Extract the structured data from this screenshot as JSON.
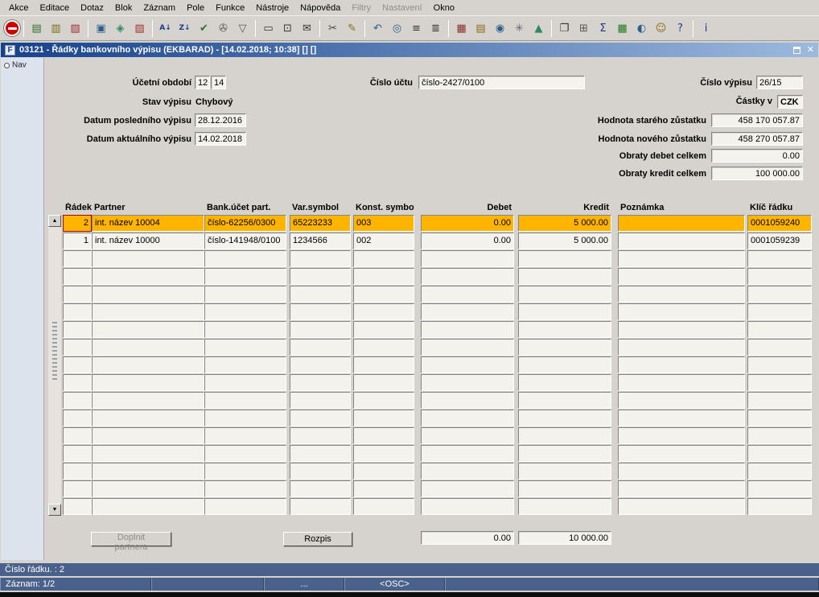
{
  "colors": {
    "window_bg": "#d6d3ce",
    "field_bg": "#f4f2ec",
    "selected_row": "#ffb400",
    "titlebar_start": "#16418c",
    "titlebar_end": "#9db9dd",
    "status_bar": "#4a618c",
    "exit_red": "#cc0000"
  },
  "menu": {
    "items": [
      {
        "label": "Akce",
        "enabled": true
      },
      {
        "label": "Editace",
        "enabled": true
      },
      {
        "label": "Dotaz",
        "enabled": true
      },
      {
        "label": "Blok",
        "enabled": true
      },
      {
        "label": "Záznam",
        "enabled": true
      },
      {
        "label": "Pole",
        "enabled": true
      },
      {
        "label": "Funkce",
        "enabled": true
      },
      {
        "label": "Nástroje",
        "enabled": true
      },
      {
        "label": "Nápověda",
        "enabled": true
      },
      {
        "label": "Filtry",
        "enabled": false
      },
      {
        "label": "Nastavení",
        "enabled": false
      },
      {
        "label": "Okno",
        "enabled": true
      }
    ]
  },
  "toolbar": {
    "items": [
      {
        "name": "exit-icon",
        "type": "exit"
      },
      {
        "type": "sep"
      },
      {
        "name": "save-icon",
        "glyph": "▤",
        "color": "#2c6e2c"
      },
      {
        "name": "open-icon",
        "glyph": "▥",
        "color": "#7a6a1a"
      },
      {
        "name": "delete-record-icon",
        "glyph": "▧",
        "color": "#a03030"
      },
      {
        "type": "sep"
      },
      {
        "name": "enter-query-icon",
        "glyph": "▣",
        "color": "#2c5e8a"
      },
      {
        "name": "execute-query-icon",
        "glyph": "◈",
        "color": "#2c8a5e"
      },
      {
        "name": "cancel-query-icon",
        "glyph": "▨",
        "color": "#a03030"
      },
      {
        "type": "sep"
      },
      {
        "name": "sort-asc-icon",
        "glyph": "A↓",
        "color": "#1a3a8a"
      },
      {
        "name": "sort-desc-icon",
        "glyph": "Z↓",
        "color": "#1a3a8a"
      },
      {
        "name": "commit-icon",
        "glyph": "✔",
        "color": "#1f7a1f"
      },
      {
        "name": "tools-icon",
        "glyph": "✇",
        "color": "#555555"
      },
      {
        "name": "filter-icon",
        "glyph": "▽",
        "color": "#555555"
      },
      {
        "type": "sep"
      },
      {
        "name": "print-icon",
        "glyph": "▭",
        "color": "#333333"
      },
      {
        "name": "print-preview-icon",
        "glyph": "⊡",
        "color": "#333333"
      },
      {
        "name": "mail-icon",
        "glyph": "✉",
        "color": "#333333"
      },
      {
        "type": "sep"
      },
      {
        "name": "cut-icon",
        "glyph": "✂",
        "color": "#444444"
      },
      {
        "name": "paste-icon",
        "glyph": "✎",
        "color": "#8a6a1a"
      },
      {
        "type": "sep"
      },
      {
        "name": "undo-icon",
        "glyph": "↶",
        "color": "#2c5e8a"
      },
      {
        "name": "search-icon",
        "glyph": "◎",
        "color": "#2c5e8a"
      },
      {
        "name": "list-icon",
        "glyph": "≡",
        "color": "#333333"
      },
      {
        "name": "detail-list-icon",
        "glyph": "≣",
        "color": "#333333"
      },
      {
        "type": "sep"
      },
      {
        "name": "calendar-icon",
        "glyph": "▦",
        "color": "#8a2c2c"
      },
      {
        "name": "document-icon",
        "glyph": "▤",
        "color": "#8a6a1a"
      },
      {
        "name": "globe-icon",
        "glyph": "◉",
        "color": "#2c5e8a"
      },
      {
        "name": "link-icon",
        "glyph": "✳",
        "color": "#556677"
      },
      {
        "name": "chart-icon",
        "glyph": "▲",
        "color": "#2c8a5e"
      },
      {
        "type": "sep"
      },
      {
        "name": "window-icon",
        "glyph": "❐",
        "color": "#333333"
      },
      {
        "name": "calculator-icon",
        "glyph": "⊞",
        "color": "#555555"
      },
      {
        "name": "sum-icon",
        "glyph": "Σ",
        "color": "#1a3a8a"
      },
      {
        "name": "export-table-icon",
        "glyph": "▦",
        "color": "#1f7a1f"
      },
      {
        "name": "web-help-icon",
        "glyph": "◐",
        "color": "#2c5e8a"
      },
      {
        "name": "assistant-icon",
        "glyph": "☺",
        "color": "#8a6a1a"
      },
      {
        "name": "help-icon",
        "glyph": "?",
        "color": "#1a3a8a"
      },
      {
        "type": "sep"
      },
      {
        "name": "info-icon",
        "glyph": "i",
        "color": "#1a3a8a"
      }
    ]
  },
  "window": {
    "icon_text": "F",
    "title": "03121 - Řádky bankovního výpisu (EKBARAD) - [14.02.2018; 10:38] [] []",
    "close_glyph": "✕"
  },
  "nav": {
    "label": "Nav"
  },
  "form": {
    "ucetni_obdobi": {
      "label": "Účetní období",
      "value1": "12",
      "value2": "14"
    },
    "cislo_uctu": {
      "label": "Číslo účtu",
      "value": "číslo-2427/0100"
    },
    "cislo_vypisu": {
      "label": "Číslo výpisu",
      "value": "26/15"
    },
    "stav_vypisu": {
      "label": "Stav výpisu",
      "value": "Chybový"
    },
    "castky_v": {
      "label": "Částky v",
      "value": "CZK"
    },
    "datum_posledniho": {
      "label": "Datum posledního výpisu",
      "value": "28.12.2016"
    },
    "datum_aktualniho": {
      "label": "Datum aktuálního výpisu",
      "value": "14.02.2018"
    },
    "hodnota_stareho": {
      "label": "Hodnota starého zůstatku",
      "value": "458 170 057.87"
    },
    "hodnota_noveho": {
      "label": "Hodnota nového zůstatku",
      "value": "458 270 057.87"
    },
    "obraty_debet": {
      "label": "Obraty debet celkem",
      "value": "0.00"
    },
    "obraty_kredit": {
      "label": "Obraty kredit celkem",
      "value": "100 000.00"
    }
  },
  "table": {
    "columns": [
      "Řádek",
      "Partner",
      "Bank.účet part.",
      "Var.symbol",
      "Konst. symbol",
      "Debet",
      "Kredit",
      "Poznámka",
      "Klíč řádku"
    ],
    "column_keys": [
      "radek",
      "partner",
      "bank-ucet-part",
      "var-symbol",
      "konst-symbol",
      "debet",
      "kredit",
      "poznamka",
      "klic-radku"
    ],
    "header_aligns": [
      "r",
      "l",
      "l",
      "l",
      "l",
      "r",
      "r",
      "l",
      "l"
    ],
    "cell_aligns": [
      "r",
      "l",
      "l",
      "l",
      "l",
      "r",
      "r",
      "l",
      "l"
    ],
    "rows": [
      {
        "selected": true,
        "cells": [
          "2",
          "int. název 10004",
          "číslo-62256/0300",
          "65223233",
          "003",
          "0.00",
          "5 000.00",
          "",
          "0001059240"
        ]
      },
      {
        "selected": false,
        "cells": [
          "1",
          "int. název 10000",
          "číslo-141948/0100",
          "1234566",
          "002",
          "0.00",
          "5 000.00",
          "",
          "0001059239"
        ]
      }
    ],
    "empty_row_count": 15
  },
  "scrollbar": {
    "up": "▲",
    "down": "▼"
  },
  "footer": {
    "doplnit_button": "Doplnit partnera",
    "rozpis_button": "Rozpis",
    "total_debet": "0.00",
    "total_kredit": "10 000.00"
  },
  "statusbar": {
    "line1": "Číslo řádku. : 2",
    "zaznam": "Záznam: 1/2",
    "dots": "...",
    "osc": "<OSC>"
  }
}
